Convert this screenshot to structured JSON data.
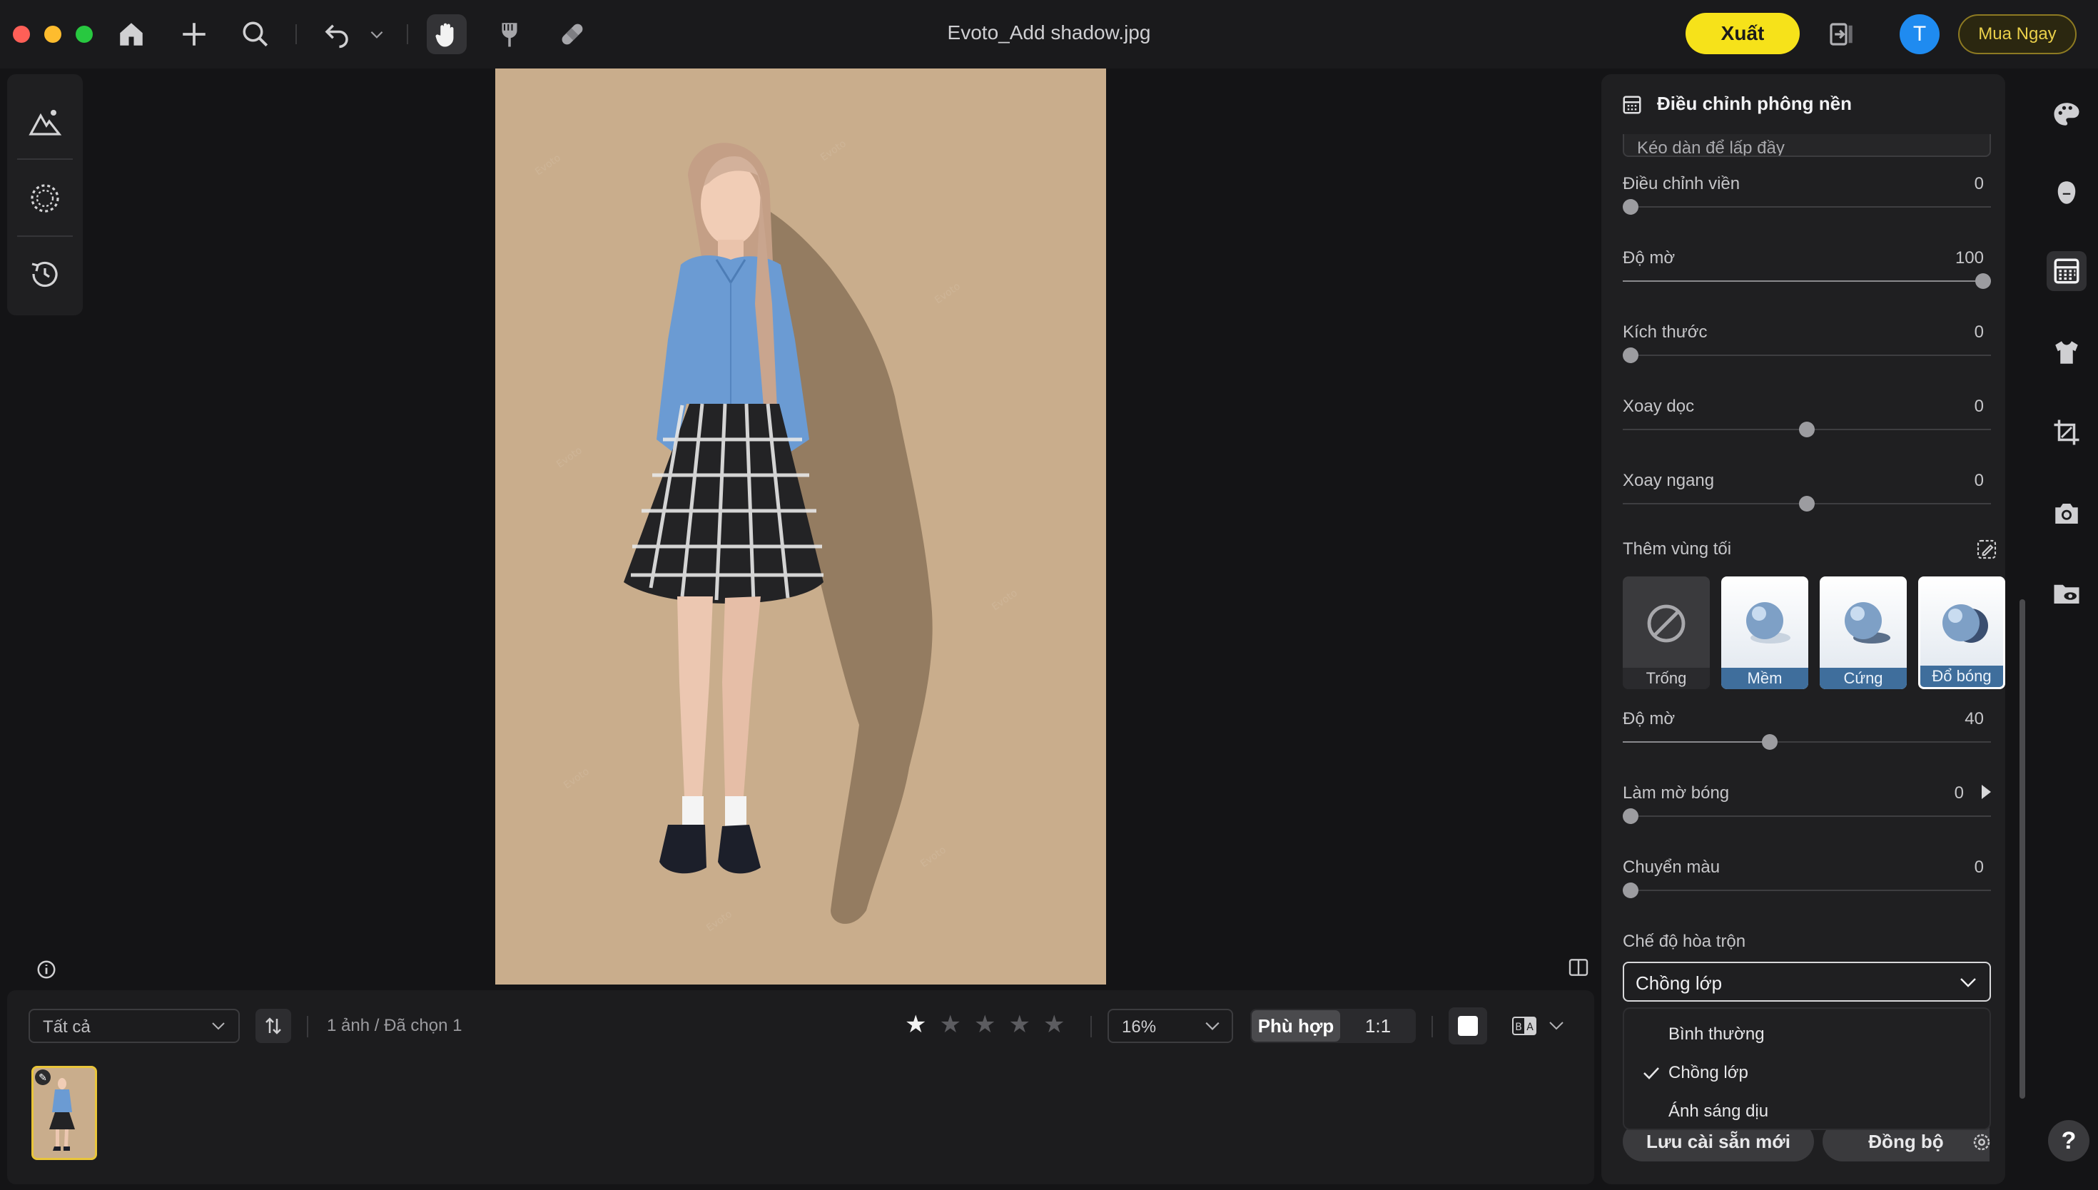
{
  "window": {
    "title": "Evoto_Add shadow.jpg"
  },
  "toolbar": {
    "export_label": "Xuất",
    "avatar_letter": "T",
    "buy_label": "Mua Ngay"
  },
  "bottom_bar": {
    "filter_value": "Tất cả",
    "count_text": "1 ảnh / Đã chọn 1",
    "rating": 1,
    "zoom_value": "16%",
    "fit_label": "Phù hợp",
    "one_to_one_label": "1:1",
    "ba_label": "B|A"
  },
  "panel": {
    "title": "Điều chỉnh phông nền",
    "cut_select_value": "Kéo dàn để lấp đầy",
    "sliders_top": [
      {
        "label": "Điều chỉnh viền",
        "value": "0",
        "fraction": 0.0
      },
      {
        "label": "Độ mờ",
        "value": "100",
        "fraction": 1.0
      },
      {
        "label": "Kích thước",
        "value": "0",
        "fraction": 0.0
      },
      {
        "label": "Xoay dọc",
        "value": "0",
        "fraction": 0.5
      },
      {
        "label": "Xoay ngang",
        "value": "0",
        "fraction": 0.5
      }
    ],
    "dark_area_label": "Thêm vùng tối",
    "shadow_options": [
      {
        "label": "Trống",
        "selected": false
      },
      {
        "label": "Mềm",
        "selected": false
      },
      {
        "label": "Cứng",
        "selected": false
      },
      {
        "label": "Đổ bóng",
        "selected": true
      }
    ],
    "sliders_bottom": [
      {
        "label": "Độ mờ",
        "value": "40",
        "fraction": 0.4
      },
      {
        "label": "Làm mờ bóng",
        "value": "0",
        "fraction": 0.0
      },
      {
        "label": "Chuyển màu",
        "value": "0",
        "fraction": 0.0
      }
    ],
    "blend_label": "Chế độ hòa trộn",
    "blend_value": "Chồng lớp",
    "blend_options": [
      {
        "label": "Bình thường",
        "checked": false
      },
      {
        "label": "Chồng lớp",
        "checked": true
      },
      {
        "label": "Ánh sáng dịu",
        "checked": false
      }
    ],
    "save_preset_label": "Lưu cài sẵn mới",
    "sync_label": "Đồng bộ"
  },
  "help_label": "?",
  "colors": {
    "accent_yellow": "#f6e21a",
    "avatar_blue": "#1f8bf0",
    "canvas_background": "#c9ad8c",
    "selection_blue": "#3f6e9c"
  }
}
